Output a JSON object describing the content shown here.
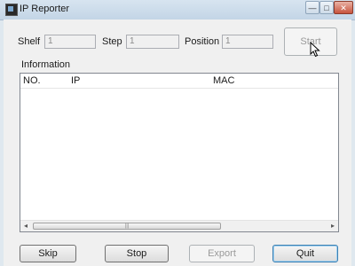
{
  "window": {
    "title": "IP Reporter",
    "min_icon": "—",
    "max_icon": "□",
    "close_icon": "✕"
  },
  "controls": {
    "shelf": {
      "label": "Shelf",
      "value": "1"
    },
    "step": {
      "label": "Step",
      "value": "1"
    },
    "position": {
      "label": "Position",
      "value": "1"
    },
    "start_label": "Start"
  },
  "information": {
    "label": "Information",
    "columns": [
      "NO.",
      "IP",
      "MAC"
    ],
    "rows": [],
    "scroll_left": "◂",
    "scroll_right": "▸",
    "thumb_grip": "|||"
  },
  "buttons": {
    "skip": "Skip",
    "stop": "Stop",
    "export": "Export",
    "quit": "Quit"
  }
}
